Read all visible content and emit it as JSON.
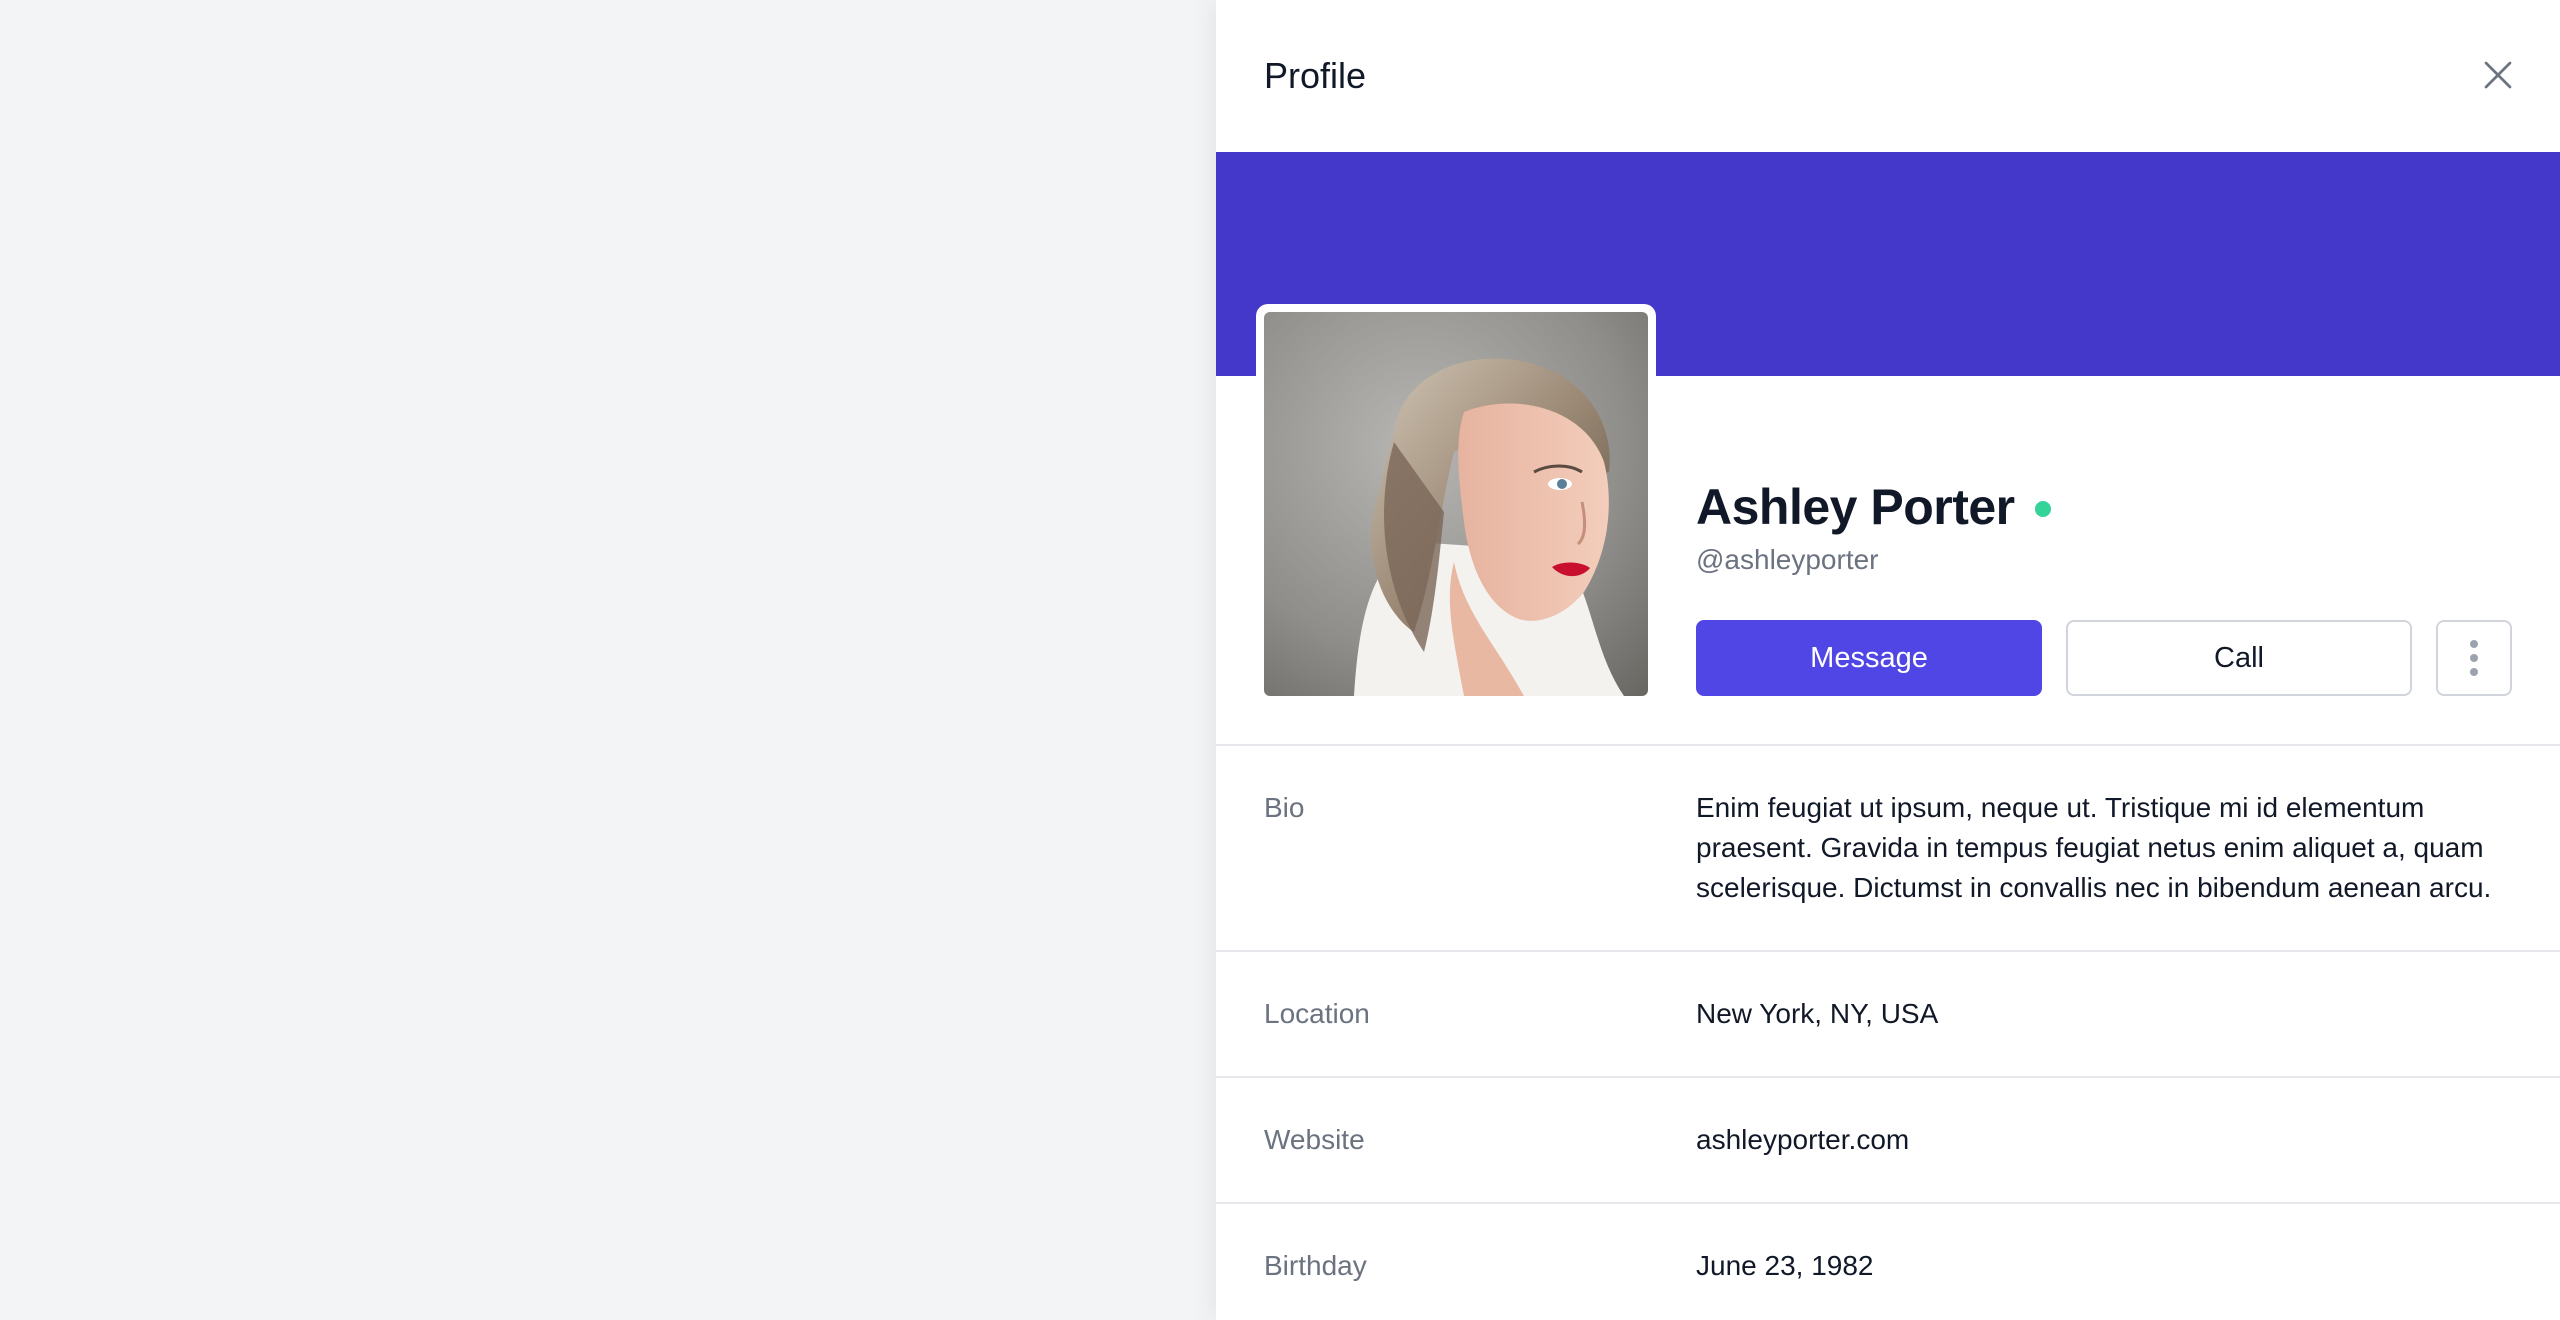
{
  "panel": {
    "title": "Profile",
    "close_icon": "close-icon"
  },
  "profile": {
    "name": "Ashley Porter",
    "handle": "@ashleyporter",
    "status": "online",
    "status_color": "#34d399",
    "cover_color": "#4338ca"
  },
  "actions": {
    "message_label": "Message",
    "call_label": "Call",
    "more_icon": "more-vertical-icon"
  },
  "details": [
    {
      "label": "Bio",
      "value": "Enim feugiat ut ipsum, neque ut. Tristique mi id elementum praesent. Gravida in tempus feugiat netus enim aliquet a, quam scelerisque. Dictumst in convallis nec in bibendum aenean arcu."
    },
    {
      "label": "Location",
      "value": "New York, NY, USA"
    },
    {
      "label": "Website",
      "value": "ashleyporter.com"
    },
    {
      "label": "Birthday",
      "value": "June 23, 1982"
    }
  ],
  "colors": {
    "accent": "#4f46e5",
    "background": "#f3f4f6"
  }
}
